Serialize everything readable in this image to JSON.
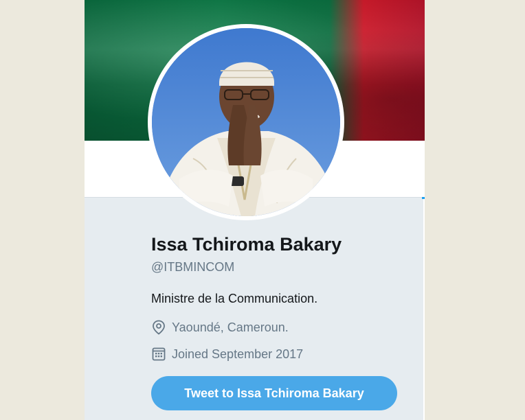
{
  "profile": {
    "name": "Issa Tchiroma Bakary",
    "handle": "@ITBMINCOM",
    "bio": "Ministre de la Communication.",
    "location": "Yaoundé, Cameroun.",
    "joined": "Joined September 2017"
  },
  "actions": {
    "tweet_to_label": "Tweet to Issa Tchiroma Bakary"
  },
  "icons": {
    "location": "location-pin-icon",
    "joined": "calendar-icon"
  },
  "colors": {
    "accent": "#1da1f2",
    "button": "#4aa8e8",
    "text_primary": "#14171a",
    "text_secondary": "#657786",
    "card_background": "#e6ecf0",
    "banner_green": "#0c7a46",
    "banner_red": "#cf1b2b"
  }
}
